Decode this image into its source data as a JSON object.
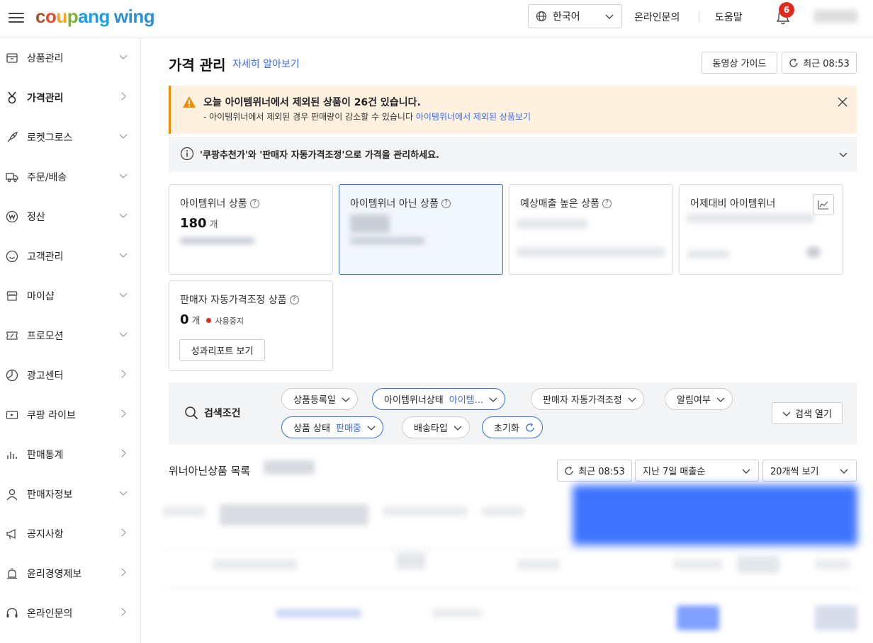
{
  "header": {
    "logo": {
      "part1": "c",
      "part2": "o",
      "part3": "u",
      "part4": "p",
      "part5": "ang",
      "wing": "wing"
    },
    "language": "한국어",
    "online_inquiry": "온라인문의",
    "help": "도움말",
    "notification_count": "6"
  },
  "sidebar": {
    "items": [
      {
        "label": "상품관리",
        "icon": "box-icon",
        "chevron": "down"
      },
      {
        "label": "가격관리",
        "icon": "medal-icon",
        "chevron": "right"
      },
      {
        "label": "로켓그로스",
        "icon": "rocket-icon",
        "chevron": "down"
      },
      {
        "label": "주문/배송",
        "icon": "truck-icon",
        "chevron": "down"
      },
      {
        "label": "정산",
        "icon": "won-icon",
        "chevron": "down"
      },
      {
        "label": "고객관리",
        "icon": "smile-icon",
        "chevron": "down"
      },
      {
        "label": "마이샵",
        "icon": "shop-icon",
        "chevron": "down"
      },
      {
        "label": "프로모션",
        "icon": "coupon-icon",
        "chevron": "down"
      },
      {
        "label": "광고센터",
        "icon": "pie-icon",
        "chevron": "right"
      },
      {
        "label": "쿠팡 라이브",
        "icon": "live-icon",
        "chevron": "right"
      },
      {
        "label": "판매통계",
        "icon": "bar-chart-icon",
        "chevron": "right"
      },
      {
        "label": "판매자정보",
        "icon": "user-icon",
        "chevron": "down"
      },
      {
        "label": "공지사항",
        "icon": "megaphone-icon",
        "chevron": "right"
      },
      {
        "label": "윤리경영제보",
        "icon": "bell-alert-icon",
        "chevron": "right"
      },
      {
        "label": "온라인문의",
        "icon": "headset-icon",
        "chevron": "right"
      }
    ]
  },
  "main": {
    "title": "가격 관리",
    "learn_more": "자세히 알아보기",
    "video_guide": "동영상 가이드",
    "refresh": "최근 08:53",
    "warning": {
      "title": "오늘 아이템위너에서 제외된 상품이 26건 있습니다.",
      "desc": "- 아이템위너에서 제외된 경우 판매량이 감소할 수 있습니다",
      "link": "아이템위너에서 제외된 상품보기"
    },
    "info": {
      "text": "'쿠팡추천가'와 '판매자 자동가격조정'으로 가격을 관리하세요."
    },
    "cards": [
      {
        "title": "아이템위너 상품",
        "value": "180",
        "unit": "개"
      },
      {
        "title": "아이템위너 아닌 상품"
      },
      {
        "title": "예상매출 높은 상품"
      },
      {
        "title": "어제대비 아이템위너"
      }
    ],
    "auto_card": {
      "title": "판매자 자동가격조정 상품",
      "value": "0",
      "unit": "개",
      "status": "사용중지",
      "report_button": "성과리포트 보기"
    },
    "search": {
      "label": "검색조건",
      "chips": [
        {
          "label": "상품등록일",
          "value": ""
        },
        {
          "label": "아이템위너상태",
          "value": "아이템..."
        },
        {
          "label": "판매자 자동가격조정",
          "value": ""
        },
        {
          "label": "알림여부",
          "value": ""
        },
        {
          "label": "상품 상태",
          "value": "판매중"
        },
        {
          "label": "배송타입",
          "value": ""
        },
        {
          "label": "초기화",
          "value": ""
        }
      ],
      "open": "검색 열기"
    },
    "list": {
      "title": "위너아닌상품 목록",
      "refresh": "최근 08:53",
      "sort": "지난 7일 매출순",
      "page_size": "20개씩 보기"
    }
  },
  "colors": {
    "accent": "#346aff",
    "warning_bg": "#fff1df",
    "warning_border": "#f08a00",
    "badge": "#e02a1e"
  }
}
